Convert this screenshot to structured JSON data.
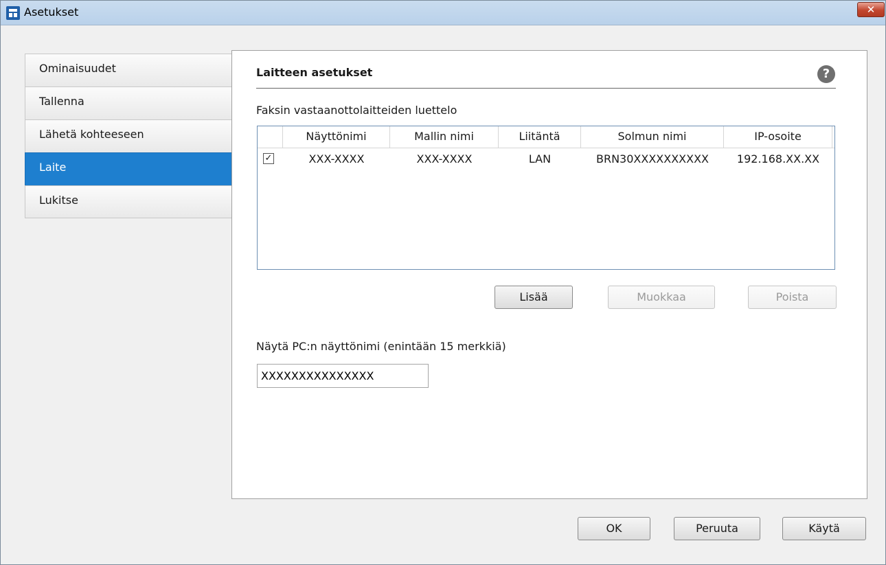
{
  "window": {
    "title": "Asetukset",
    "close_label": "✕"
  },
  "sidebar": {
    "items": [
      {
        "label": "Ominaisuudet"
      },
      {
        "label": "Tallenna"
      },
      {
        "label": "Lähetä kohteeseen"
      },
      {
        "label": "Laite",
        "active": true
      },
      {
        "label": "Lukitse"
      }
    ]
  },
  "panel": {
    "section_title": "Laitteen asetukset",
    "help_label": "?",
    "list_label": "Faksin vastaanottolaitteiden luettelo",
    "table": {
      "headers": [
        "Näyttönimi",
        "Mallin nimi",
        "Liitäntä",
        "Solmun nimi",
        "IP-osoite"
      ],
      "rows": [
        {
          "checked": true,
          "check_glyph": "✓",
          "cells": [
            "XXX-XXXX",
            "XXX-XXXX",
            "LAN",
            "BRN30XXXXXXXXXX",
            "192.168.XX.XX"
          ]
        }
      ]
    },
    "buttons": {
      "add": "Lisää",
      "edit": "Muokkaa",
      "remove": "Poista"
    },
    "pc_label": "Näytä PC:n näyttönimi (enintään 15 merkkiä)",
    "pc_value": "XXXXXXXXXXXXXXX"
  },
  "footer": {
    "ok": "OK",
    "cancel": "Peruuta",
    "apply": "Käytä"
  },
  "colors": {
    "accent": "#1e7fcf",
    "close": "#c2472f",
    "titlebar": "#c9dcef"
  }
}
